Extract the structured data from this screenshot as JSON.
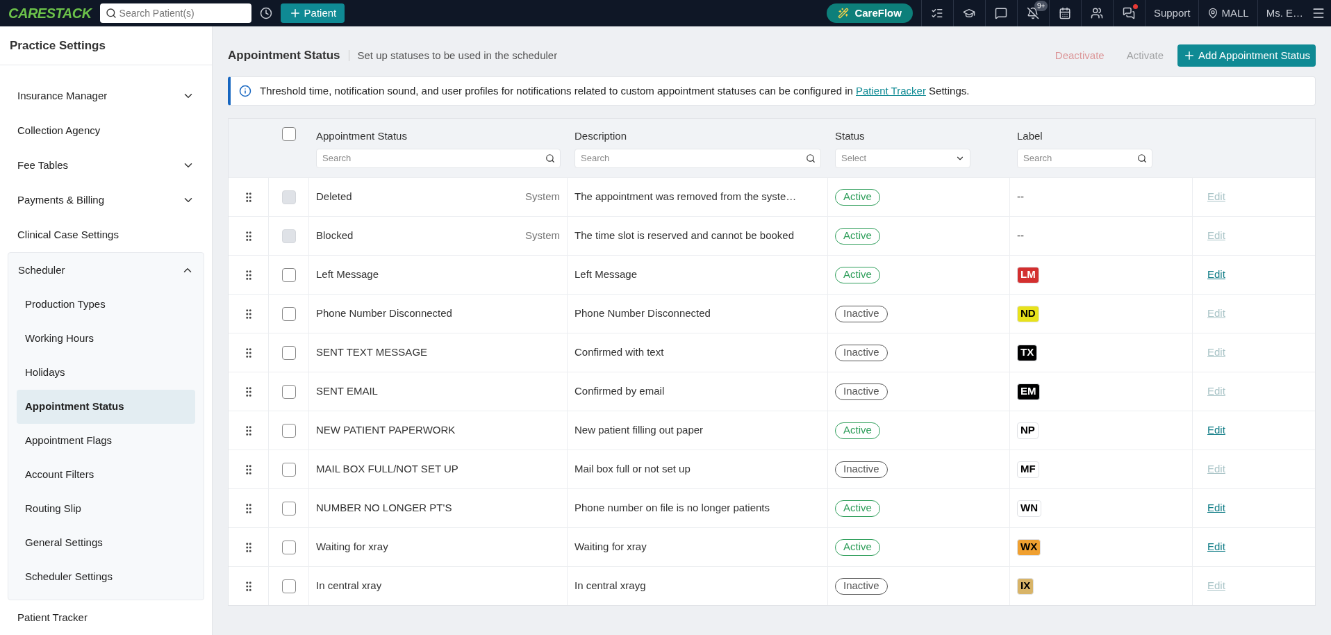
{
  "topbar": {
    "logo": "CARESTACK",
    "search_placeholder": "Search Patient(s)",
    "patient_button": "Patient",
    "careflow_button": "CareFlow",
    "notification_badge": "9+",
    "chat_alert": true,
    "support": "Support",
    "location": "MALL",
    "user": "Ms. E…"
  },
  "sidebar": {
    "title": "Practice Settings",
    "items": [
      {
        "label": "Insurance Manager",
        "expanded": false
      },
      {
        "label": "Collection Agency"
      },
      {
        "label": "Fee Tables",
        "expanded": false
      },
      {
        "label": "Payments & Billing",
        "expanded": false
      },
      {
        "label": "Clinical Case Settings"
      },
      {
        "label": "Scheduler",
        "expanded": true,
        "children": [
          {
            "label": "Production Types",
            "selected": false
          },
          {
            "label": "Working Hours",
            "selected": false
          },
          {
            "label": "Holidays",
            "selected": false
          },
          {
            "label": "Appointment Status",
            "selected": true
          },
          {
            "label": "Appointment Flags",
            "selected": false
          },
          {
            "label": "Account Filters",
            "selected": false
          },
          {
            "label": "Routing Slip",
            "selected": false
          },
          {
            "label": "General Settings",
            "selected": false
          },
          {
            "label": "Scheduler Settings",
            "selected": false
          }
        ]
      },
      {
        "label": "Patient Tracker"
      }
    ]
  },
  "page": {
    "title": "Appointment Status",
    "subtitle": "Set up statuses to be used in the scheduler",
    "actions": [
      {
        "label": "Deactivate",
        "kind": "danger",
        "disabled": true
      },
      {
        "label": "Activate",
        "kind": "plain",
        "disabled": true
      },
      {
        "label": "Add Appointment Status",
        "kind": "primary",
        "disabled": false
      }
    ]
  },
  "banner": {
    "text_before": "Threshold time, notification sound, and user profiles for notifications related to custom appointment statuses can be configured in",
    "link": "Patient Tracker",
    "text_after": "Settings."
  },
  "table": {
    "header_checked": false,
    "columns": [
      {
        "label": "Appointment Status",
        "filter": {
          "kind": "search",
          "placeholder": "Search"
        }
      },
      {
        "label": "Description",
        "filter": {
          "kind": "search",
          "placeholder": "Search"
        }
      },
      {
        "label": "Status",
        "filter": {
          "kind": "select",
          "placeholder": "Select"
        }
      },
      {
        "label": "Label",
        "filter": {
          "kind": "search",
          "placeholder": "Search"
        }
      }
    ],
    "rows": [
      {
        "name": "Deleted",
        "tag": "System",
        "description": "The appointment was removed from the syste…",
        "status": "Active",
        "active": true,
        "label": "--",
        "edit": "Edit",
        "edit_enabled": false,
        "checked": false,
        "checkbox_disabled": true
      },
      {
        "name": "Blocked",
        "tag": "System",
        "description": "The time slot is reserved and cannot be booked",
        "status": "Active",
        "active": true,
        "label": "--",
        "edit": "Edit",
        "edit_enabled": false,
        "checked": false,
        "checkbox_disabled": true
      },
      {
        "name": "Left Message",
        "description": "Left Message",
        "status": "Active",
        "active": true,
        "label": "LM",
        "color": "#d32f2f",
        "edit": "Edit",
        "edit_enabled": true,
        "checked": false,
        "checkbox_disabled": false
      },
      {
        "name": "Phone Number Disconnected",
        "description": "Phone Number Disconnected",
        "status": "Inactive",
        "active": false,
        "label": "ND",
        "color": "#e8e21c",
        "edit": "Edit",
        "edit_enabled": false,
        "checked": false,
        "checkbox_disabled": false
      },
      {
        "name": "SENT TEXT MESSAGE",
        "description": "Confirmed with text",
        "status": "Inactive",
        "active": false,
        "label": "TX",
        "color": "#000000",
        "edit": "Edit",
        "edit_enabled": false,
        "checked": false,
        "checkbox_disabled": false
      },
      {
        "name": "SENT EMAIL",
        "description": "Confirmed by email",
        "status": "Inactive",
        "active": false,
        "label": "EM",
        "color": "#000000",
        "edit": "Edit",
        "edit_enabled": false,
        "checked": false,
        "checkbox_disabled": false
      },
      {
        "name": "NEW PATIENT PAPERWORK",
        "description": "New patient filling out paper",
        "status": "Active",
        "active": true,
        "label": "NP",
        "color": "#ffffff",
        "edit": "Edit",
        "edit_enabled": true,
        "checked": false,
        "checkbox_disabled": false
      },
      {
        "name": "MAIL BOX FULL/NOT SET UP",
        "description": "Mail box full or not set up",
        "status": "Inactive",
        "active": false,
        "label": "MF",
        "color": "#ffffff",
        "edit": "Edit",
        "edit_enabled": false,
        "checked": false,
        "checkbox_disabled": false
      },
      {
        "name": "NUMBER NO LONGER PT'S",
        "description": "Phone number on file is no longer patients",
        "status": "Active",
        "active": true,
        "label": "WN",
        "color": "#ffffff",
        "edit": "Edit",
        "edit_enabled": true,
        "checked": false,
        "checkbox_disabled": false
      },
      {
        "name": "Waiting for xray",
        "description": "Waiting for xray",
        "status": "Active",
        "active": true,
        "label": "WX",
        "color": "#f0a030",
        "edit": "Edit",
        "edit_enabled": true,
        "checked": false,
        "checkbox_disabled": false
      },
      {
        "name": "In central xray",
        "description": "In central xrayg",
        "status": "Inactive",
        "active": false,
        "label": "IX",
        "color": "#d8b468",
        "edit": "Edit",
        "edit_enabled": false,
        "checked": false,
        "checkbox_disabled": false
      }
    ]
  }
}
